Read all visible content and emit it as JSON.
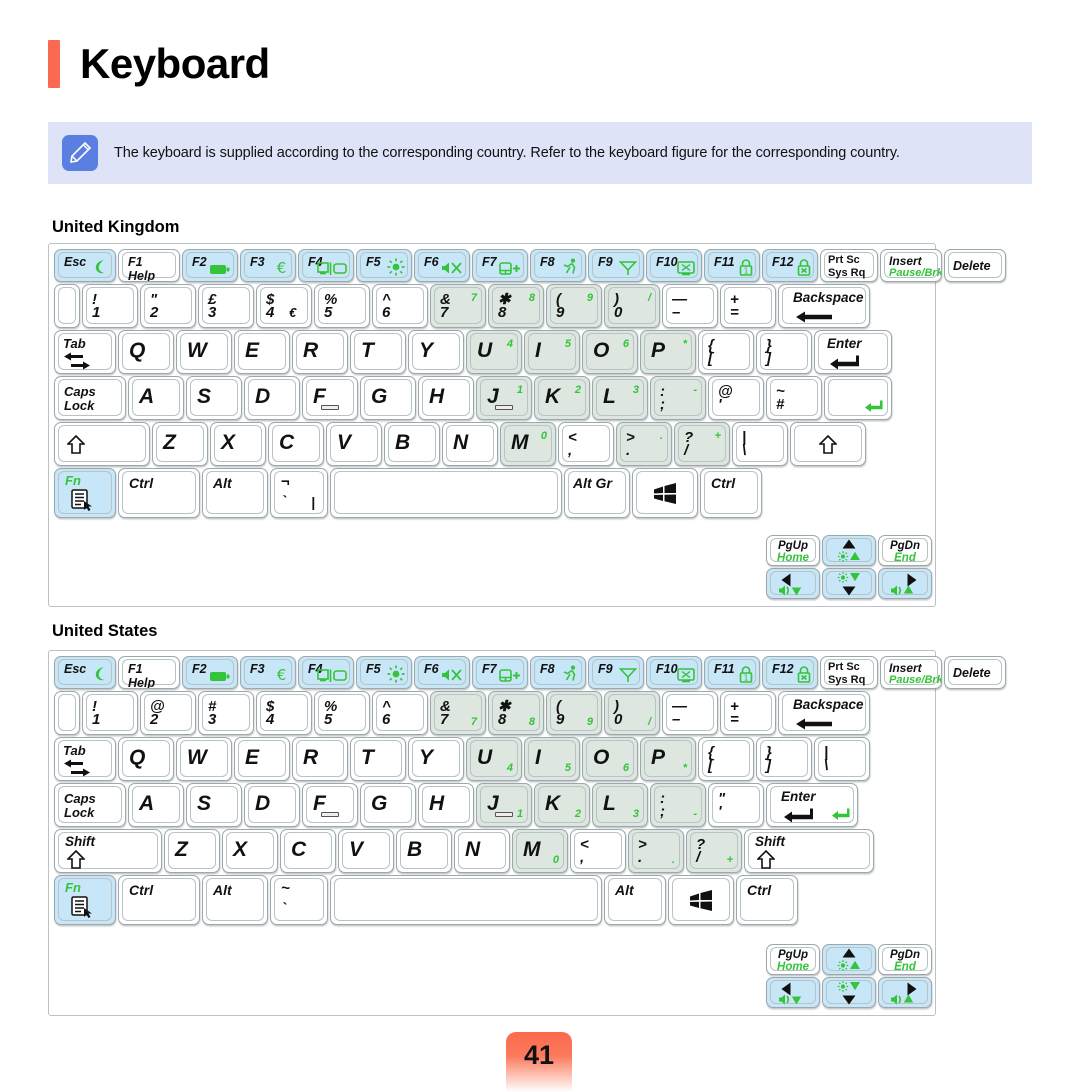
{
  "header": {
    "title": "Keyboard",
    "accent_color": "#fa6a50"
  },
  "note": {
    "icon": "pencil-icon",
    "text": "The keyboard is supplied according to the corresponding country. Refer to the keyboard figure for the corresponding country.",
    "background_color": "#dfe3f7",
    "icon_color": "#5b7fe0"
  },
  "colors": {
    "fn_blue": "#c7e6f7",
    "numpad_green": "#dde7e0",
    "green_legend": "#34c43a",
    "key_border": "#9aa9ad"
  },
  "sections": [
    {
      "id": "uk",
      "label": "United Kingdom"
    },
    {
      "id": "us",
      "label": "United States"
    }
  ],
  "legends": {
    "esc": "Esc",
    "f1": "F1",
    "f1_sub": "Help",
    "f2": "F2",
    "f3": "F3",
    "f4": "F4",
    "f5": "F5",
    "f6": "F6",
    "f7": "F7",
    "f8": "F8",
    "f9": "F9",
    "f10": "F10",
    "f11": "F11",
    "f12": "F12",
    "prtsc": "Prt Sc",
    "sysrq": "Sys Rq",
    "insert": "Insert",
    "pausebrk": "Pause/Brk",
    "delete": "Delete",
    "backspace": "Backspace",
    "tab": "Tab",
    "capslock_1": "Caps",
    "capslock_2": "Lock",
    "enter": "Enter",
    "shift": "Shift",
    "fn": "Fn",
    "ctrl": "Ctrl",
    "alt": "Alt",
    "altgr": "Alt Gr",
    "pgup": "PgUp",
    "home": "Home",
    "pgdn": "PgDn",
    "end": "End",
    "win": "windows-logo-icon",
    "menu": "menu-icon"
  },
  "fnrow_icons": [
    {
      "key": "F2",
      "icon": "battery-icon"
    },
    {
      "key": "F3",
      "icon": "euro-icon"
    },
    {
      "key": "F4",
      "icon": "display-switch-icon"
    },
    {
      "key": "F5",
      "icon": "brightness-icon"
    },
    {
      "key": "F6",
      "icon": "mute-icon"
    },
    {
      "key": "F7",
      "icon": "touchpad-icon"
    },
    {
      "key": "F8",
      "icon": "performance-icon"
    },
    {
      "key": "F9",
      "icon": "wireless-icon"
    },
    {
      "key": "F10",
      "icon": "screen-off-icon"
    },
    {
      "key": "F11",
      "icon": "lock-icon"
    },
    {
      "key": "F12",
      "icon": "security-lock-icon"
    }
  ],
  "uk": {
    "name": "United Kingdom",
    "number_row": [
      {
        "top": "!",
        "bottom": "1"
      },
      {
        "top": "\"",
        "bottom": "2"
      },
      {
        "top": "£",
        "bottom": "3"
      },
      {
        "top": "$",
        "bottom": "4",
        "extra": "€"
      },
      {
        "top": "%",
        "bottom": "5"
      },
      {
        "top": "^",
        "bottom": "6"
      },
      {
        "top": "&",
        "bottom": "7",
        "green": "7",
        "numpad": true
      },
      {
        "top": "✱",
        "bottom": "8",
        "green": "8",
        "numpad": true
      },
      {
        "top": "(",
        "bottom": "9",
        "green": "9",
        "numpad": true
      },
      {
        "top": ")",
        "bottom": "0",
        "green": "/",
        "numpad": true
      },
      {
        "top": "—",
        "bottom": "–"
      },
      {
        "top": "+",
        "bottom": "="
      }
    ],
    "qwerty_row": [
      {
        "main": "Q"
      },
      {
        "main": "W"
      },
      {
        "main": "E"
      },
      {
        "main": "R"
      },
      {
        "main": "T"
      },
      {
        "main": "Y"
      },
      {
        "main": "U",
        "green": "4",
        "numpad": true
      },
      {
        "main": "I",
        "green": "5",
        "numpad": true
      },
      {
        "main": "O",
        "green": "6",
        "numpad": true
      },
      {
        "main": "P",
        "green": "*",
        "numpad": true
      },
      {
        "top": "{",
        "bottom": "["
      },
      {
        "top": "}",
        "bottom": "]"
      }
    ],
    "home_row": [
      {
        "main": "A"
      },
      {
        "main": "S"
      },
      {
        "main": "D"
      },
      {
        "main": "F",
        "homebar": true
      },
      {
        "main": "G"
      },
      {
        "main": "H"
      },
      {
        "main": "J",
        "green": "1",
        "numpad": true,
        "homebar": true
      },
      {
        "main": "K",
        "green": "2",
        "numpad": true
      },
      {
        "main": "L",
        "green": "3",
        "numpad": true
      },
      {
        "top": ":",
        "bottom": ";",
        "green": "-",
        "numpad": true
      },
      {
        "top": "@",
        "bottom": "'"
      },
      {
        "top": "~",
        "bottom": "#"
      }
    ],
    "bottom_letter_row": [
      {
        "main": "Z"
      },
      {
        "main": "X"
      },
      {
        "main": "C"
      },
      {
        "main": "V"
      },
      {
        "main": "B"
      },
      {
        "main": "N"
      },
      {
        "main": "M",
        "green": "0",
        "numpad": true
      },
      {
        "top": "<",
        "bottom": ","
      },
      {
        "top": ">",
        "bottom": ".",
        "green": ".",
        "numpad": true
      },
      {
        "top": "?",
        "bottom": "/",
        "green": "+",
        "numpad": true
      },
      {
        "top": "|",
        "bottom": "\\"
      }
    ],
    "shift_left_label": "",
    "shift_right_label": "",
    "bottom_row": [
      "Fn",
      "Ctrl",
      "Alt",
      "backslash-key",
      "space",
      "Alt Gr",
      "windows-logo-icon",
      "Ctrl"
    ],
    "backslash_key": {
      "top": "¬",
      "bottom": "`",
      "extra": "|"
    },
    "enter_shape": "L-shaped"
  },
  "us": {
    "name": "United States",
    "number_row": [
      {
        "top": "!",
        "bottom": "1"
      },
      {
        "top": "@",
        "bottom": "2"
      },
      {
        "top": "#",
        "bottom": "3"
      },
      {
        "top": "$",
        "bottom": "4"
      },
      {
        "top": "%",
        "bottom": "5"
      },
      {
        "top": "^",
        "bottom": "6"
      },
      {
        "top": "&",
        "bottom": "7",
        "green": "7",
        "numpad": true
      },
      {
        "top": "✱",
        "bottom": "8",
        "green": "8",
        "numpad": true
      },
      {
        "top": "(",
        "bottom": "9",
        "green": "9",
        "numpad": true
      },
      {
        "top": ")",
        "bottom": "0",
        "green": "/",
        "numpad": true
      },
      {
        "top": "—",
        "bottom": "–"
      },
      {
        "top": "+",
        "bottom": "="
      }
    ],
    "qwerty_row": [
      {
        "main": "Q"
      },
      {
        "main": "W"
      },
      {
        "main": "E"
      },
      {
        "main": "R"
      },
      {
        "main": "T"
      },
      {
        "main": "Y"
      },
      {
        "main": "U",
        "green": "4",
        "numpad": true
      },
      {
        "main": "I",
        "green": "5",
        "numpad": true
      },
      {
        "main": "O",
        "green": "6",
        "numpad": true
      },
      {
        "main": "P",
        "green": "*",
        "numpad": true
      },
      {
        "top": "{",
        "bottom": "["
      },
      {
        "top": "}",
        "bottom": "]"
      },
      {
        "top": "|",
        "bottom": "\\"
      }
    ],
    "home_row": [
      {
        "main": "A"
      },
      {
        "main": "S"
      },
      {
        "main": "D"
      },
      {
        "main": "F",
        "homebar": true
      },
      {
        "main": "G"
      },
      {
        "main": "H"
      },
      {
        "main": "J",
        "green": "1",
        "numpad": true,
        "homebar": true
      },
      {
        "main": "K",
        "green": "2",
        "numpad": true
      },
      {
        "main": "L",
        "green": "3",
        "numpad": true
      },
      {
        "top": ":",
        "bottom": ";",
        "green": "-",
        "numpad": true
      },
      {
        "top": "\"",
        "bottom": "'"
      }
    ],
    "bottom_letter_row": [
      {
        "main": "Z"
      },
      {
        "main": "X"
      },
      {
        "main": "C"
      },
      {
        "main": "V"
      },
      {
        "main": "B"
      },
      {
        "main": "N"
      },
      {
        "main": "M",
        "green": "0",
        "numpad": true
      },
      {
        "top": "<",
        "bottom": ","
      },
      {
        "top": ">",
        "bottom": ".",
        "green": ".",
        "numpad": true
      },
      {
        "top": "?",
        "bottom": "/",
        "green": "+",
        "numpad": true
      }
    ],
    "shift_left_label": "Shift",
    "shift_right_label": "Shift",
    "bottom_row": [
      "Fn",
      "Ctrl",
      "Alt",
      "tilde-key",
      "space",
      "Alt",
      "windows-logo-icon",
      "Ctrl"
    ],
    "tilde_key": {
      "top": "~",
      "bottom": "`"
    },
    "enter_shape": "straight"
  },
  "footer": {
    "page_number": "41"
  }
}
